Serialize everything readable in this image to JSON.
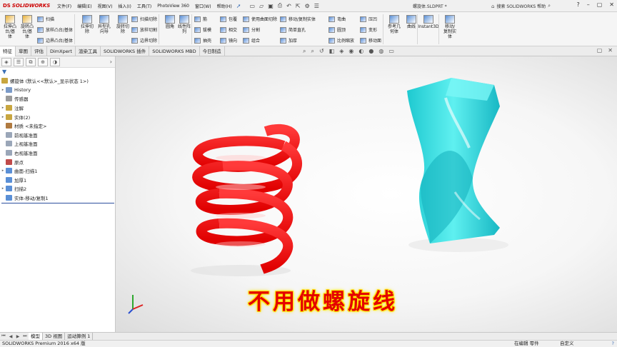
{
  "app": {
    "brand": "SOLIDWORKS",
    "menu": [
      "文件(F)",
      "编辑(E)",
      "视图(V)",
      "插入(I)",
      "工具(T)",
      "PhotoView 360",
      "窗口(W)",
      "帮助(H)"
    ],
    "document_title": "螺旋体.SLDPRT *",
    "search_placeholder": "搜索 SOLIDWORKS 帮助"
  },
  "ribbon": {
    "big": [
      {
        "label": "拉伸凸\n台/基\n体",
        "color": "#e8b13a"
      },
      {
        "label": "旋转凸\n台/基\n体",
        "color": "#e8b13a"
      },
      {
        "label": "拉伸切\n除",
        "color": "#5a8fd6"
      },
      {
        "label": "异型孔\n向导",
        "color": "#5a8fd6"
      },
      {
        "label": "旋转切\n除",
        "color": "#5a8fd6"
      },
      {
        "label": "圆角",
        "color": "#5a8fd6"
      },
      {
        "label": "线性阵\n列",
        "color": "#5a8fd6"
      },
      {
        "label": "参考几\n何体",
        "color": "#5a8fd6"
      },
      {
        "label": "曲线",
        "color": "#5a8fd6"
      },
      {
        "label": "Instant3D",
        "color": "#5a8fd6"
      },
      {
        "label": "移动/\n复制实\n体",
        "color": "#5a8fd6"
      }
    ],
    "small": [
      "扫描",
      "放样凸台/基体",
      "边界凸台/基体",
      "扫描切除",
      "放样切割",
      "边界切除",
      "筋",
      "拔模",
      "抽壳",
      "包覆",
      "相交",
      "镜向",
      "使用曲面切除",
      "分割",
      "组合",
      "移动/复制实体",
      "简单直孔",
      "加厚",
      "弯曲",
      "圆顶",
      "比例缩放",
      "压凹",
      "变形",
      "移动面"
    ]
  },
  "command_tabs": [
    "特征",
    "草图",
    "评估",
    "DimXpert",
    "渲染工具",
    "SOLIDWORKS 插件",
    "SOLIDWORKS MBD",
    "今日制造"
  ],
  "tree": {
    "root": "螺旋体 (默认<<默认>_显示状态 1>)",
    "items": [
      {
        "label": "History",
        "expand": true,
        "color": "#7a9ac8"
      },
      {
        "label": "传感器",
        "expand": false,
        "color": "#9a9a9a"
      },
      {
        "label": "注解",
        "expand": true,
        "color": "#c8a640"
      },
      {
        "label": "实体(2)",
        "expand": true,
        "color": "#c8a640"
      },
      {
        "label": "材质 <未指定>",
        "expand": false,
        "color": "#b07a40"
      },
      {
        "label": "前视基准面",
        "expand": false,
        "color": "#9aa6b8"
      },
      {
        "label": "上视基准面",
        "expand": false,
        "color": "#9aa6b8"
      },
      {
        "label": "右视基准面",
        "expand": false,
        "color": "#9aa6b8"
      },
      {
        "label": "原点",
        "expand": false,
        "color": "#c04a4a"
      },
      {
        "label": "曲面-扫描1",
        "expand": true,
        "color": "#5a8fd6"
      },
      {
        "label": "加厚1",
        "expand": false,
        "color": "#5a8fd6"
      },
      {
        "label": "扫描2",
        "expand": true,
        "color": "#5a8fd6"
      },
      {
        "label": "实体-移动/复制1",
        "expand": false,
        "color": "#5a8fd6"
      }
    ]
  },
  "caption": "不用做螺旋线",
  "bottom_tabs": [
    "模型",
    "3D 视图",
    "运动算例 1"
  ],
  "status": {
    "left": "SOLIDWORKS Premium 2016 x64 版",
    "mid": "在编辑 零件",
    "right": "自定义"
  },
  "colors": {
    "spiral": "#ff1a1a",
    "twist": "#33e0e0",
    "caption": "#e40000",
    "caption_glow": "#ffe400"
  }
}
